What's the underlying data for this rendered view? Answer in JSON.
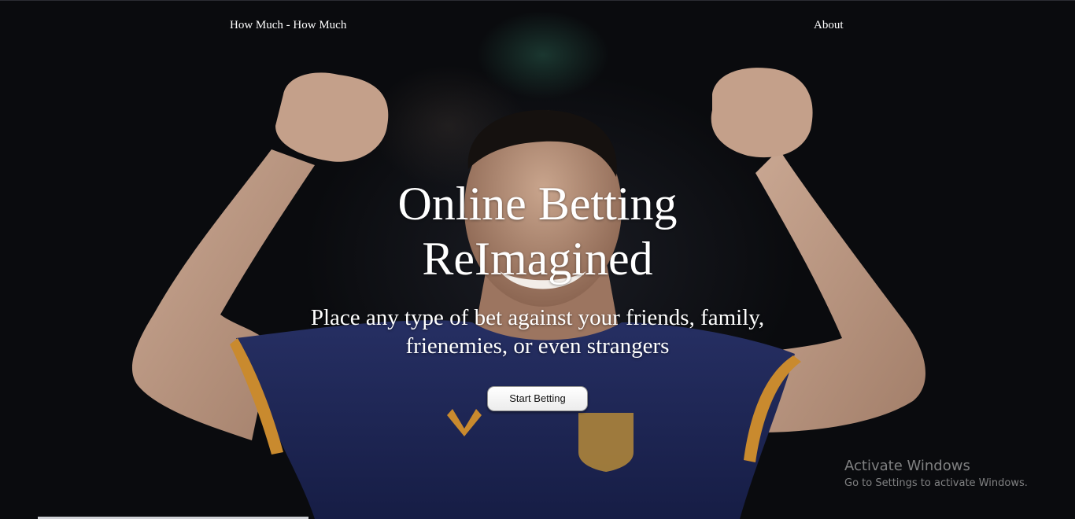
{
  "nav": {
    "brand": "How Much - How Much",
    "about": "About"
  },
  "hero": {
    "headline_line1": "Online Betting",
    "headline_line2": "ReImagined",
    "subheading_line1": "Place any type of bet against your friends, family,",
    "subheading_line2": "frienemies, or even strangers",
    "cta_label": "Start Betting",
    "background_image": "football-player-celebrating"
  },
  "watermark": {
    "title": "Activate Windows",
    "subtitle": "Go to Settings to activate Windows."
  },
  "colors": {
    "background": "#0b0c10",
    "jersey_navy": "#1e2857",
    "jersey_trim": "#c98a2e",
    "text": "#ffffff"
  }
}
